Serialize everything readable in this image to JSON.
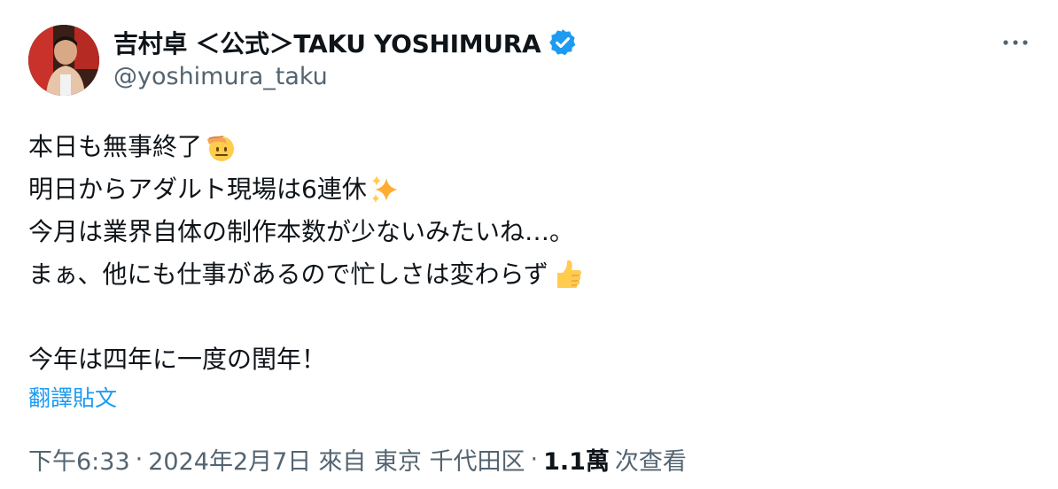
{
  "author": {
    "name": "吉村卓 ＜公式＞TAKU YOSHIMURA",
    "handle": "@yoshimura_taku",
    "verified": true,
    "verified_color": "#1d9bf0"
  },
  "more_icon": "more-horizontal-icon",
  "post": {
    "lines": [
      {
        "text": "本日も無事終了",
        "emoji": "saluting-face-emoji"
      },
      {
        "text": "明日からアダルト現場は6連休",
        "emoji": "sparkles-emoji"
      },
      {
        "text": "今月は業界自体の制作本数が少ないみたいね…。",
        "emoji": ""
      },
      {
        "text": "まぁ、他にも仕事があるので忙しさは変わらず",
        "emoji": "thumbs-up-emoji"
      },
      {
        "text": "",
        "emoji": ""
      },
      {
        "text": "今年は四年に一度の閏年！",
        "emoji": ""
      }
    ]
  },
  "translate_label": "翻譯貼文",
  "meta": {
    "time": "下午6:33",
    "separator": "·",
    "date": "2024年2月7日",
    "location": "來自 東京 千代田区",
    "views_count": "1.1萬",
    "views_label": "次查看"
  },
  "colors": {
    "text": "#0f1419",
    "secondary": "#536471",
    "link": "#1d9bf0"
  }
}
